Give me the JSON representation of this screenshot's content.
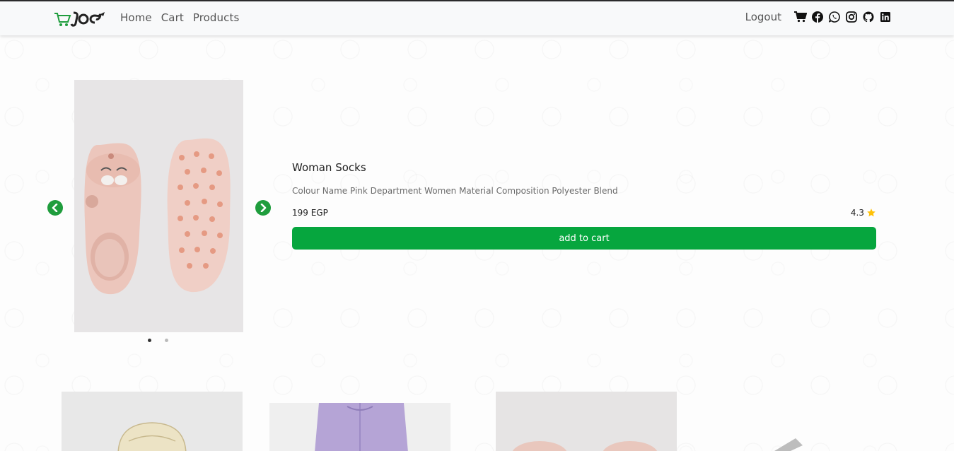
{
  "nav": {
    "brand": "logo",
    "links": [
      "Home",
      "Cart",
      "Products"
    ],
    "logout": "Logout",
    "icons": [
      "cart-icon",
      "facebook-icon",
      "whatsapp-icon",
      "instagram-icon",
      "github-icon",
      "linkedin-icon"
    ]
  },
  "product": {
    "title": "Woman Socks",
    "description": "Colour Name Pink Department Women Material Composition Polyester Blend",
    "price": "199 EGP",
    "rating": "4.3",
    "add_to_cart": "add to cart",
    "slider_pages": 2,
    "active_slide": 1
  },
  "colors": {
    "accent": "#06a63e",
    "arrow": "#1f9d3d",
    "star": "#ffc107"
  }
}
